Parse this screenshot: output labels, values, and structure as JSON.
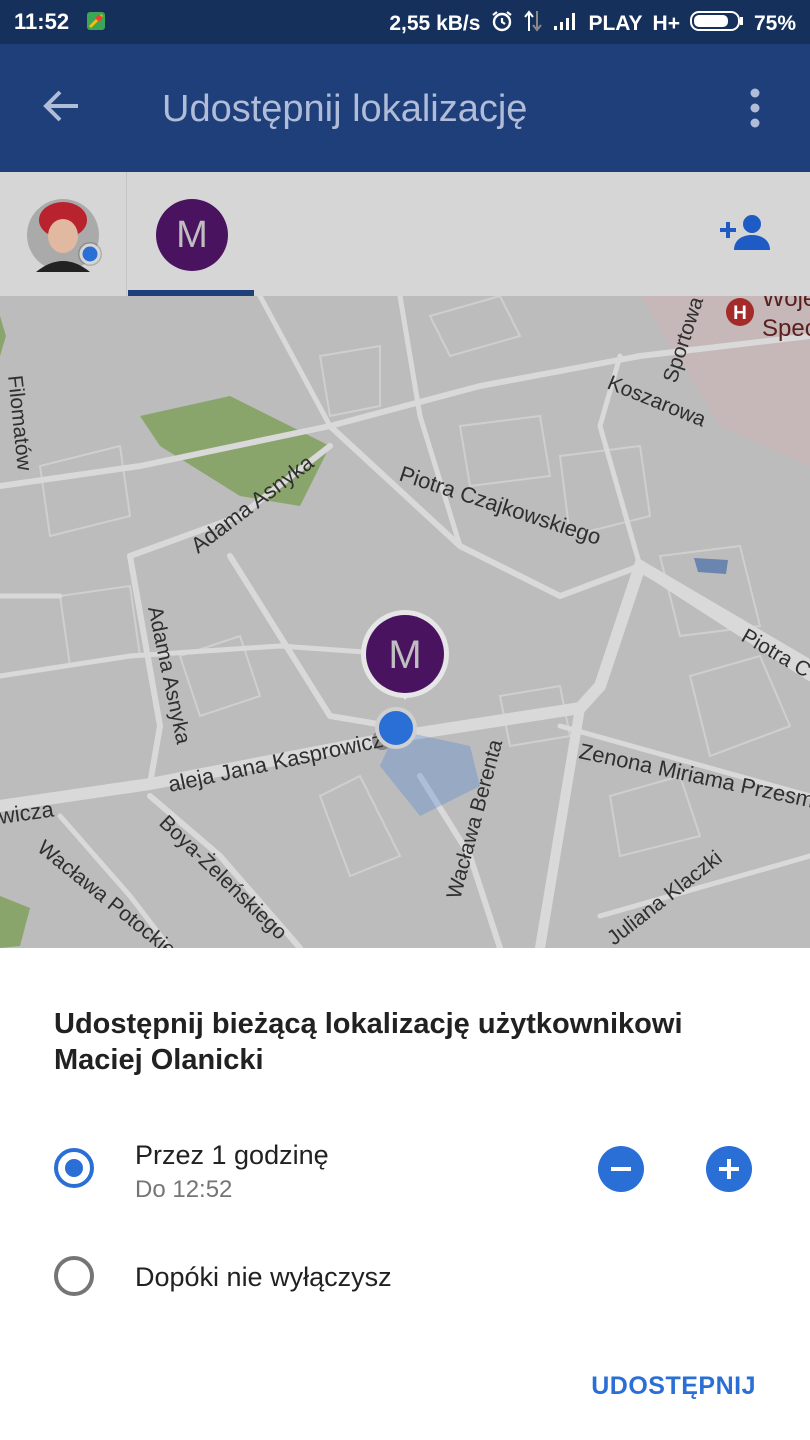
{
  "status_bar": {
    "time": "11:52",
    "speed": "2,55 kB/s",
    "carrier": "PLAY",
    "network": "H+",
    "battery": "75%"
  },
  "app_bar": {
    "title": "Udostępnij lokalizację",
    "back_icon": "arrow-back-icon",
    "menu_icon": "more-vert-icon"
  },
  "tabs": {
    "contact_initial": "M",
    "add_person_icon": "person-add-icon"
  },
  "map": {
    "streets": [
      "Filomatów",
      "Koszarowa",
      "Sportowa",
      "Piotra Czajkowskiego",
      "Adama Asnyka",
      "Adama Asnyka",
      "aleja Jana Kasprowicza",
      "wicza",
      "Boya-Żeleńskiego",
      "Wacława Potockiego",
      "Wacława Berenta",
      "Zenona Miriama Przesmyckiego",
      "Juliana Klaczki",
      "Piotra C",
      "Woje",
      "Spec"
    ],
    "marker_initial": "M",
    "hospital_symbol": "H"
  },
  "sheet": {
    "headline": "Udostępnij bieżącą lokalizację użytkownikowi Maciej Olanicki",
    "option1_label": "Przez 1 godzinę",
    "option1_sub": "Do 12:52",
    "option2_label": "Dopóki nie wyłączysz",
    "share_button": "UDOSTĘPNIJ"
  },
  "colors": {
    "accent": "#2a6fd6",
    "app_bar": "#1e3f7a",
    "avatar": "#4a1360"
  }
}
